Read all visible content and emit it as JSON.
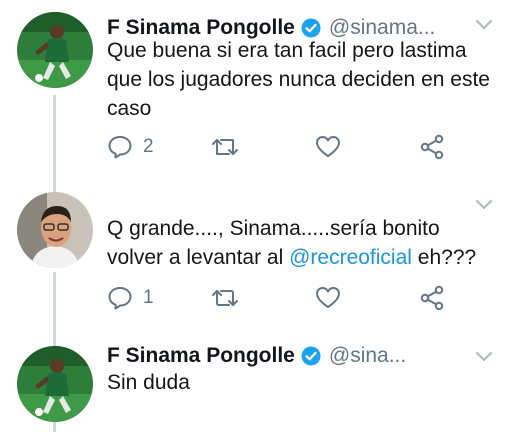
{
  "tweets": [
    {
      "author_name": "F Sinama Pongolle",
      "handle": "@sinama...",
      "verified": true,
      "text": "Que buena si era tan facil pero lastima que los jugadores nunca deciden en este caso",
      "replies": "2",
      "retweets": "",
      "likes": ""
    },
    {
      "author_name": "",
      "handle": "",
      "verified": false,
      "text_before": "Q grande...., Sinama.....sería bonito volver a levantar al ",
      "mention": "@recreoficial",
      "text_after": " eh???",
      "replies": "1",
      "retweets": "",
      "likes": ""
    },
    {
      "author_name": "F Sinama Pongolle",
      "handle": "@sina...",
      "verified": true,
      "text": "Sin duda"
    }
  ],
  "icons": {
    "reply": "reply-icon",
    "retweet": "retweet-icon",
    "like": "heart-icon",
    "share": "share-icon",
    "more": "chevron-down-icon",
    "verified": "verified-badge-icon"
  },
  "colors": {
    "text": "#14171a",
    "secondary": "#657786",
    "link": "#1b95e0",
    "verified": "#1da1f2",
    "thread_line": "#ccd6dd"
  }
}
